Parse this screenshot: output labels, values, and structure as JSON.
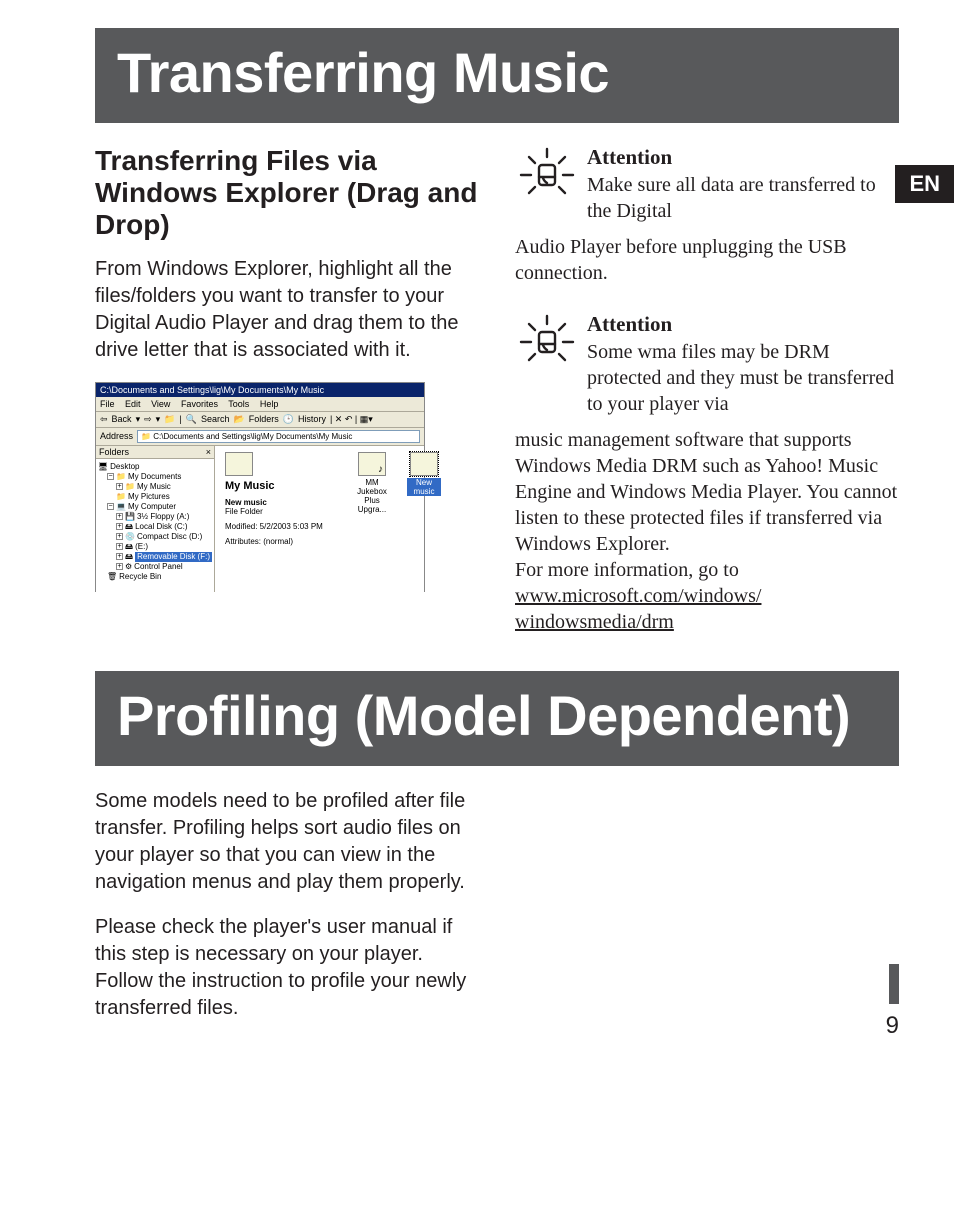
{
  "banners": {
    "transferring": "Transferring Music",
    "profiling": "Profiling (Model Dependent)"
  },
  "lang_tag": "EN",
  "section1": {
    "heading": "Transferring Files via Windows Explorer (Drag and Drop)",
    "body": "From Windows Explorer, highlight all the files/folders you want to transfer to your Digital Audio Player and drag them to the drive letter that is associated with it."
  },
  "attention1": {
    "title": "Attention",
    "lead": "Make sure all data are transferred to the Digital",
    "continue": "Audio Player before unplugging the USB connection."
  },
  "attention2": {
    "title": "Attention",
    "lead": "Some wma files may be DRM protected and they must be transferred to your player via",
    "continue1": "music management software that supports Windows Media DRM such as Yahoo! Music Engine and Windows Media Player. You cannot listen to these protected files if transferred via Windows Explorer.",
    "continue2": "For more information, go to ",
    "link": "www.microsoft.com/windows/ windowsmedia/drm"
  },
  "section2": {
    "p1": "Some models need to be profiled after file transfer. Profiling helps sort audio files on your player so that you can view in the navigation menus and play them properly.",
    "p2": "Please check the player's user manual if this step is necessary on your player. Follow the instruction to profile your newly transferred files."
  },
  "explorer": {
    "titlebar": "C:\\Documents and Settings\\lig\\My Documents\\My Music",
    "menu": {
      "file": "File",
      "edit": "Edit",
      "view": "View",
      "favorites": "Favorites",
      "tools": "Tools",
      "help": "Help"
    },
    "toolbar": {
      "back": "Back",
      "search": "Search",
      "folders": "Folders",
      "history": "History"
    },
    "address_label": "Address",
    "address_value": "C:\\Documents and Settings\\lig\\My Documents\\My Music",
    "tree": {
      "header": "Folders",
      "close": "×",
      "desktop": "Desktop",
      "mydocs": "My Documents",
      "mymusic": "My Music",
      "mypics": "My Pictures",
      "mycomp": "My Computer",
      "floppy": "3½ Floppy (A:)",
      "localc": "Local Disk (C:)",
      "cdrom": "Compact Disc (D:)",
      "drive_e": "(E:)",
      "removable": "Removable Disk (F:)",
      "ctrl": "Control Panel",
      "recycle": "Recycle Bin"
    },
    "info": {
      "title": "My Music",
      "folder_name": "New music",
      "type": "File Folder",
      "modified": "Modified: 5/2/2003 5:03 PM",
      "attrs": "Attributes: (normal)"
    },
    "icons": {
      "item1a": "MM Jukebox",
      "item1b": "Plus Upgra...",
      "item2": "New music"
    }
  },
  "page_number": "9"
}
